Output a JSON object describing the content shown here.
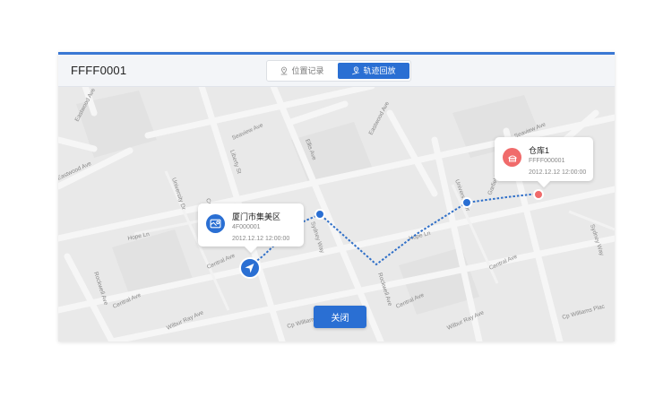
{
  "header": {
    "title": "FFFF0001"
  },
  "tabs": [
    {
      "label": "位置记录",
      "icon": "location-record-icon",
      "active": false
    },
    {
      "label": "轨迹回放",
      "icon": "track-playback-icon",
      "active": true
    }
  ],
  "map": {
    "streets": [
      "Eastwood Ave",
      "Seaview Ave",
      "Eastwood Ave",
      "Seaview Ave",
      "Ellis Ave",
      "Eastwood Ave",
      "Liberty St",
      "University Dr",
      "Cp",
      "Hope Ln",
      "Sydney Way",
      "University Dr",
      "Garfield Ct",
      "Hope Ln",
      "Sydney Way",
      "Central Ave",
      "Central Ave",
      "Rockwell Ave",
      "Central Ave",
      "Rockwell Ave",
      "Central Ave",
      "Wilbur Ray Ave",
      "Cp Williams Pl",
      "Wilbur Ray Ave",
      "Cp Williams Plac"
    ]
  },
  "cards": {
    "start": {
      "name": "厦门市集美区",
      "code": "4F000001",
      "time": "2012.12.12 12:00:00",
      "icon": "map-location-icon",
      "color": "#2a6fd3"
    },
    "end": {
      "name": "仓库1",
      "code": "FFFF000001",
      "time": "2012.12.12 12:00:00",
      "icon": "warehouse-icon",
      "color": "#f06b6b"
    }
  },
  "footer": {
    "close_label": "关闭"
  },
  "colors": {
    "accent": "#2a6fd3",
    "route": "#2f6fc8",
    "end_marker": "#f06b6b"
  }
}
